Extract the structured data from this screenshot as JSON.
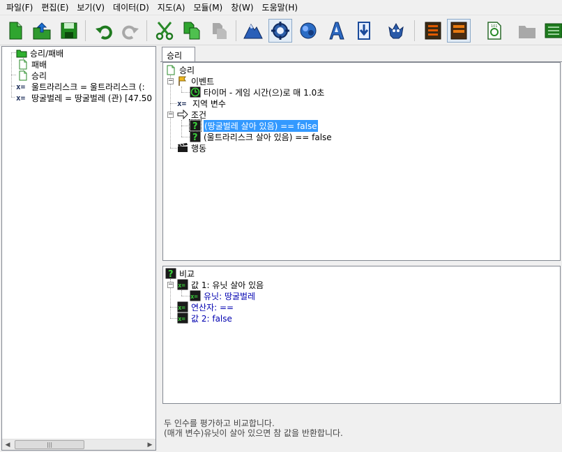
{
  "menu": {
    "items": [
      "파일(F)",
      "편집(E)",
      "보기(V)",
      "데이터(D)",
      "지도(A)",
      "모듈(M)",
      "창(W)",
      "도움말(H)"
    ]
  },
  "toolbar": {
    "buttons": [
      {
        "name": "new-icon"
      },
      {
        "name": "open-icon"
      },
      {
        "name": "save-icon"
      },
      {
        "name": "undo-icon"
      },
      {
        "name": "redo-icon"
      },
      {
        "name": "cut-icon"
      },
      {
        "name": "copy-icon"
      },
      {
        "name": "paste-icon"
      },
      {
        "name": "terrain-module-icon"
      },
      {
        "name": "trigger-module-icon"
      },
      {
        "name": "data-module-icon"
      },
      {
        "name": "text-module-icon"
      },
      {
        "name": "import-module-icon"
      },
      {
        "name": "ai-module-icon"
      },
      {
        "name": "cutscene-module-icon"
      },
      {
        "name": "preview-module-icon"
      },
      {
        "name": "test-document-icon"
      },
      {
        "name": "folder-icon"
      },
      {
        "name": "console-icon"
      }
    ]
  },
  "left_tree": {
    "items": [
      {
        "label": "승리/패배",
        "icon": "folder-icon"
      },
      {
        "label": "패배",
        "icon": "trigger-page-icon"
      },
      {
        "label": "승리",
        "icon": "trigger-page-icon"
      },
      {
        "label": "울트라리스크 = 울트라리스크 (:",
        "icon": "variable-icon"
      },
      {
        "label": "땅굴벌레 = 땅굴벌레 (관) [47.50",
        "icon": "variable-icon"
      }
    ],
    "var_glyph": "x="
  },
  "tabs": {
    "active": "승리"
  },
  "trigger": {
    "name": "승리",
    "events_label": "이벤트",
    "event_1": "타이머 - 게임 시간(으)로 매 1.0초",
    "local_vars_label": "지역 변수",
    "conditions_label": "조건",
    "condition_1": "(땅굴벌레 살아 있음) == false",
    "condition_2": "(울트라리스크 살아 있음) == false",
    "actions_label": "행동"
  },
  "function": {
    "name": "비교",
    "value1": "값 1: 유닛 살아 있음",
    "unit": "유닛: 땅굴벌레",
    "operator": "연산자: ==",
    "value2": "값 2: false"
  },
  "description": {
    "line1": "두 인수를 평가하고 비교합니다.",
    "line2": "(매개 변수)유닛이 살아 있으면 참 값을 반환합니다."
  },
  "colors": {
    "selection": "#3399ff",
    "param_text": "#0000b0"
  }
}
